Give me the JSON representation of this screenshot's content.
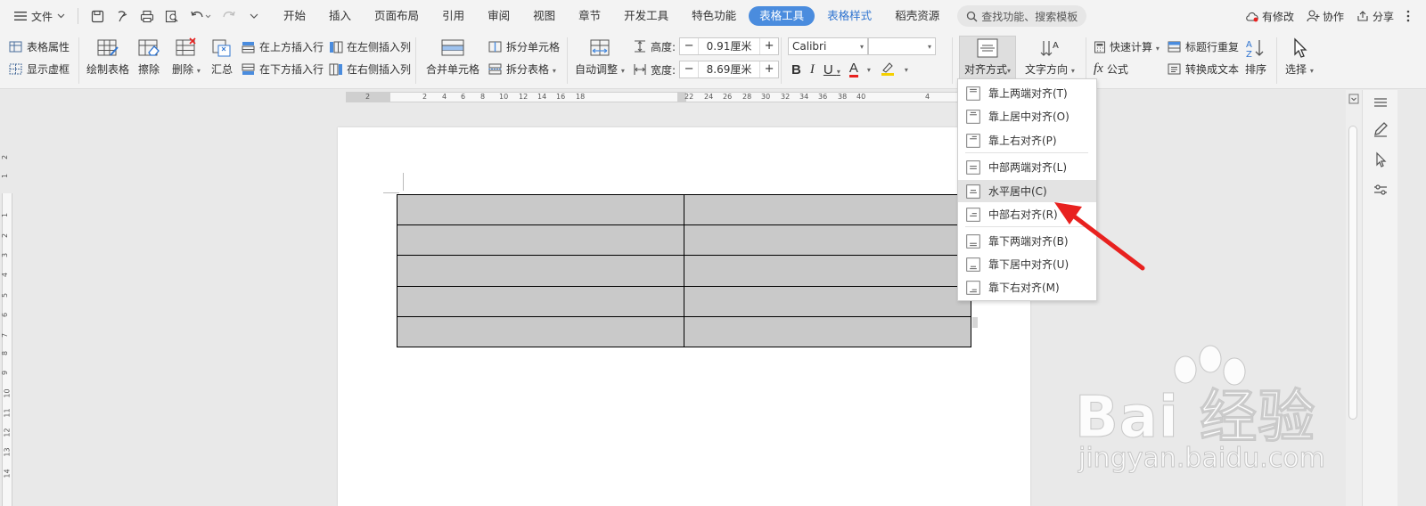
{
  "menubar": {
    "file_label": "文件",
    "tabs": [
      {
        "label": "开始",
        "style": "normal"
      },
      {
        "label": "插入",
        "style": "normal"
      },
      {
        "label": "页面布局",
        "style": "normal"
      },
      {
        "label": "引用",
        "style": "normal"
      },
      {
        "label": "审阅",
        "style": "normal"
      },
      {
        "label": "视图",
        "style": "normal"
      },
      {
        "label": "章节",
        "style": "normal"
      },
      {
        "label": "开发工具",
        "style": "normal"
      },
      {
        "label": "特色功能",
        "style": "normal"
      },
      {
        "label": "表格工具",
        "style": "context"
      },
      {
        "label": "表格样式",
        "style": "colored"
      },
      {
        "label": "稻壳资源",
        "style": "normal"
      }
    ],
    "search_placeholder": "查找功能、搜索模板",
    "right": {
      "changes": "有修改",
      "collab": "协作",
      "share": "分享"
    }
  },
  "ribbon": {
    "table_props": "表格属性",
    "show_gridlines": "显示虚框",
    "draw_table": "绘制表格",
    "erase": "擦除",
    "delete": "删除",
    "summary": "汇总",
    "insert_above": "在上方插入行",
    "insert_below": "在下方插入行",
    "insert_left": "在左侧插入列",
    "insert_right": "在右侧插入列",
    "merge_cells": "合并单元格",
    "split_cells": "拆分单元格",
    "split_table": "拆分表格",
    "auto_fit": "自动调整",
    "height_label": "高度:",
    "height_value": "0.91厘米",
    "width_label": "宽度:",
    "width_value": "8.69厘米",
    "font_name": "Calibri",
    "font_size": "",
    "align": "对齐方式",
    "text_direction": "文字方向",
    "quick_calc": "快速计算",
    "formula": "公式",
    "repeat_header": "标题行重复",
    "convert_text": "转换成文本",
    "sort": "排序",
    "select": "选择"
  },
  "ruler": {
    "top_numbers": [
      "2",
      "2",
      "4",
      "6",
      "8",
      "10",
      "12",
      "14",
      "16",
      "18",
      "22",
      "24",
      "26",
      "28",
      "30",
      "32",
      "34",
      "36",
      "38",
      "40",
      "4"
    ],
    "left_numbers": [
      "2",
      "1",
      "1",
      "2",
      "3",
      "4",
      "5",
      "6",
      "7",
      "8",
      "9",
      "10",
      "11",
      "12",
      "13",
      "14"
    ]
  },
  "align_menu": {
    "items": [
      {
        "label": "靠上两端对齐(T)",
        "state": "normal"
      },
      {
        "label": "靠上居中对齐(O)",
        "state": "normal"
      },
      {
        "label": "靠上右对齐(P)",
        "state": "normal"
      },
      {
        "label": "中部两端对齐(L)",
        "state": "normal"
      },
      {
        "label": "水平居中(C)",
        "state": "hover"
      },
      {
        "label": "中部右对齐(R)",
        "state": "normal"
      },
      {
        "label": "靠下两端对齐(B)",
        "state": "normal"
      },
      {
        "label": "靠下居中对齐(U)",
        "state": "normal"
      },
      {
        "label": "靠下右对齐(M)",
        "state": "normal"
      }
    ]
  },
  "table": {
    "rows": 5,
    "cols": 2,
    "cell_fill": "#c9c9c9"
  },
  "watermark": {
    "brand": "Bai  经验",
    "url": "jingyan.baidu.com"
  },
  "colors": {
    "accent": "#4a8cde",
    "arrow": "#e8211f",
    "tab_colored": "#2f74d0"
  }
}
